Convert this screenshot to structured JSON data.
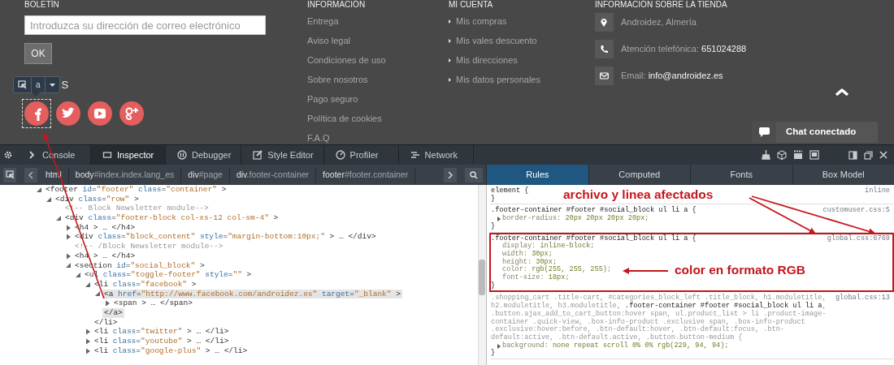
{
  "footer": {
    "newsletter": {
      "heading": "BOLETÍN",
      "placeholder": "Introduzca su dirección de correo electrónico",
      "button": "OK"
    },
    "highlighter_tooltip": {
      "tag": "a"
    },
    "social": {
      "heading_fragment": "S",
      "items": [
        {
          "kind": "facebook",
          "highlighted": true
        },
        {
          "kind": "twitter",
          "highlighted": false
        },
        {
          "kind": "youtube",
          "highlighted": false
        },
        {
          "kind": "google-plus",
          "highlighted": false
        }
      ]
    },
    "info": {
      "heading": "INFORMACIÓN",
      "links": [
        "Entrega",
        "Aviso legal",
        "Condiciones de uso",
        "Sobre nosotros",
        "Pago seguro",
        "Política de cookies",
        "F.A.Q"
      ]
    },
    "account": {
      "heading": "MI CUENTA",
      "links": [
        "Mis compras",
        "Mis vales descuento",
        "Mis direcciones",
        "Mis datos personales"
      ]
    },
    "store": {
      "heading": "INFORMACIÓN SOBRE LA TIENDA",
      "items": [
        {
          "kind": "location",
          "label": "Androidez, Almería"
        },
        {
          "kind": "phone",
          "label": "Atención telefónica:",
          "value": "651024288"
        },
        {
          "kind": "email",
          "label": "Email:",
          "value": "info@androidez.es"
        }
      ]
    },
    "chat": {
      "label": "Chat conectado"
    }
  },
  "devtools": {
    "tabs": [
      {
        "kind": "console",
        "label": "Console",
        "selected": false
      },
      {
        "kind": "inspector",
        "label": "Inspector",
        "selected": true
      },
      {
        "kind": "debugger",
        "label": "Debugger",
        "selected": false
      },
      {
        "kind": "style-editor",
        "label": "Style Editor",
        "selected": false
      },
      {
        "kind": "profiler",
        "label": "Profiler",
        "selected": false
      },
      {
        "kind": "network",
        "label": "Network",
        "selected": false
      }
    ],
    "breadcrumbs": [
      {
        "tag": "html"
      },
      {
        "tag": "body",
        "detail": "#index.index.lang_es"
      },
      {
        "tag": "div",
        "detail": "#page"
      },
      {
        "tag": "div",
        "detail": ".footer-container"
      },
      {
        "tag": "footer",
        "detail": "#footer.container"
      }
    ],
    "sidebar_tabs": [
      {
        "label": "Rules",
        "selected": true
      },
      {
        "label": "Computed",
        "selected": false
      },
      {
        "label": "Fonts",
        "selected": false
      },
      {
        "label": "Box Model",
        "selected": false
      }
    ],
    "markup": [
      {
        "text": "<footer id=\"footer\" class=\"container\" >",
        "expanded": true,
        "selected": false,
        "children": [
          {
            "text": "<div class=\"row\" >",
            "expanded": true,
            "selected": false,
            "children": [
              {
                "kind": "comment",
                "text": "<!-- Block Newsletter module-->",
                "selected": false
              },
              {
                "text": "<div class=\"footer-block col-xs-12 col-sm-4\" >",
                "expanded": true,
                "selected": false,
                "children": [
                  {
                    "text": "<h4 > … </h4>",
                    "expanded": false,
                    "selected": false
                  },
                  {
                    "text": "<div class=\"block_content\" style=\"margin-bottom:10px;\" > … </div>",
                    "expanded": false,
                    "selected": false
                  },
                  {
                    "kind": "comment",
                    "text": "<!-- /Block Newsletter module-->",
                    "selected": false
                  },
                  {
                    "text": "<h4 > … </h4>",
                    "expanded": false,
                    "selected": false
                  },
                  {
                    "text": "<section id=\"social_block\" >",
                    "expanded": true,
                    "selected": false,
                    "children": [
                      {
                        "text": "<ul class=\"toggle-footer\" style=\"\" >",
                        "expanded": true,
                        "selected": false,
                        "children": [
                          {
                            "text": "<li class=\"facebook\" >",
                            "expanded": true,
                            "selected": false,
                            "close": "</li>",
                            "children": [
                              {
                                "text": "<a href=\"http://www.facebook.com/androidez.es\" target=\"_blank\" >",
                                "expanded": true,
                                "selected": true,
                                "close": "</a>",
                                "children": [
                                  {
                                    "text": "<span > … </span>",
                                    "expanded": false,
                                    "selected": false
                                  }
                                ]
                              }
                            ]
                          },
                          {
                            "text": "<li class=\"twitter\" > … </li>",
                            "expanded": false,
                            "selected": false
                          },
                          {
                            "text": "<li class=\"youtube\" > … </li>",
                            "expanded": false,
                            "selected": false
                          },
                          {
                            "text": "<li class=\"google-plus\" > … </li>",
                            "expanded": false,
                            "selected": false
                          }
                        ]
                      }
                    ]
                  }
                ]
              }
            ]
          }
        ]
      }
    ],
    "rules": [
      {
        "selector": "element {",
        "source": "inline",
        "partial_match": false,
        "annotated": false,
        "close": "}"
      },
      {
        "selector": ".footer-container #footer #social_block ul li a {",
        "source": "customuser.css:5",
        "partial_match": false,
        "annotated": false,
        "declarations": [
          {
            "property": "border-radius:",
            "value": "20px 20px 20px 20px;",
            "expandable": true
          }
        ],
        "close": "}"
      },
      {
        "selector": ".footer-container #footer #social_block ul li a {",
        "source": "global.css:6769",
        "partial_match": false,
        "annotated": true,
        "declarations": [
          {
            "property": "display:",
            "value": "inline-block;",
            "expandable": false
          },
          {
            "property": "width:",
            "value": "30px;",
            "expandable": false
          },
          {
            "property": "height:",
            "value": "30px;",
            "expandable": false
          },
          {
            "property": "color:",
            "value": "rgb(255, 255, 255);",
            "expandable": false
          },
          {
            "property": "font-size:",
            "value": "18px;",
            "expandable": false
          }
        ],
        "close": "}"
      },
      {
        "selector": ".shopping_cart .title-cart, #categories_block_left .title_block, h1.moduletitle, h2.moduletitle, h3.moduletitle, **.footer-container #footer #social_block ul li a**, .button.ajax_add_to_cart_button:hover span, ul.product_list > li .product-image-container .quick-view, .box-info-product .exclusive span, .box-info-product .exclusive:hover:before, .btn-default:hover, .btn-default:focus, .btn-default:active, .btn-default.active, .button.button-medium {",
        "source": "global.css:13",
        "partial_match": true,
        "annotated": false,
        "declarations": [
          {
            "property": "background:",
            "value": "none repeat scroll 0% 0% rgb(229, 94, 94);",
            "expandable": true
          }
        ],
        "close": "}"
      }
    ]
  },
  "annotations": [
    {
      "kind": "file-line",
      "text": "archivo y linea afectados"
    },
    {
      "kind": "rgb",
      "text": "color en formato RGB"
    }
  ]
}
